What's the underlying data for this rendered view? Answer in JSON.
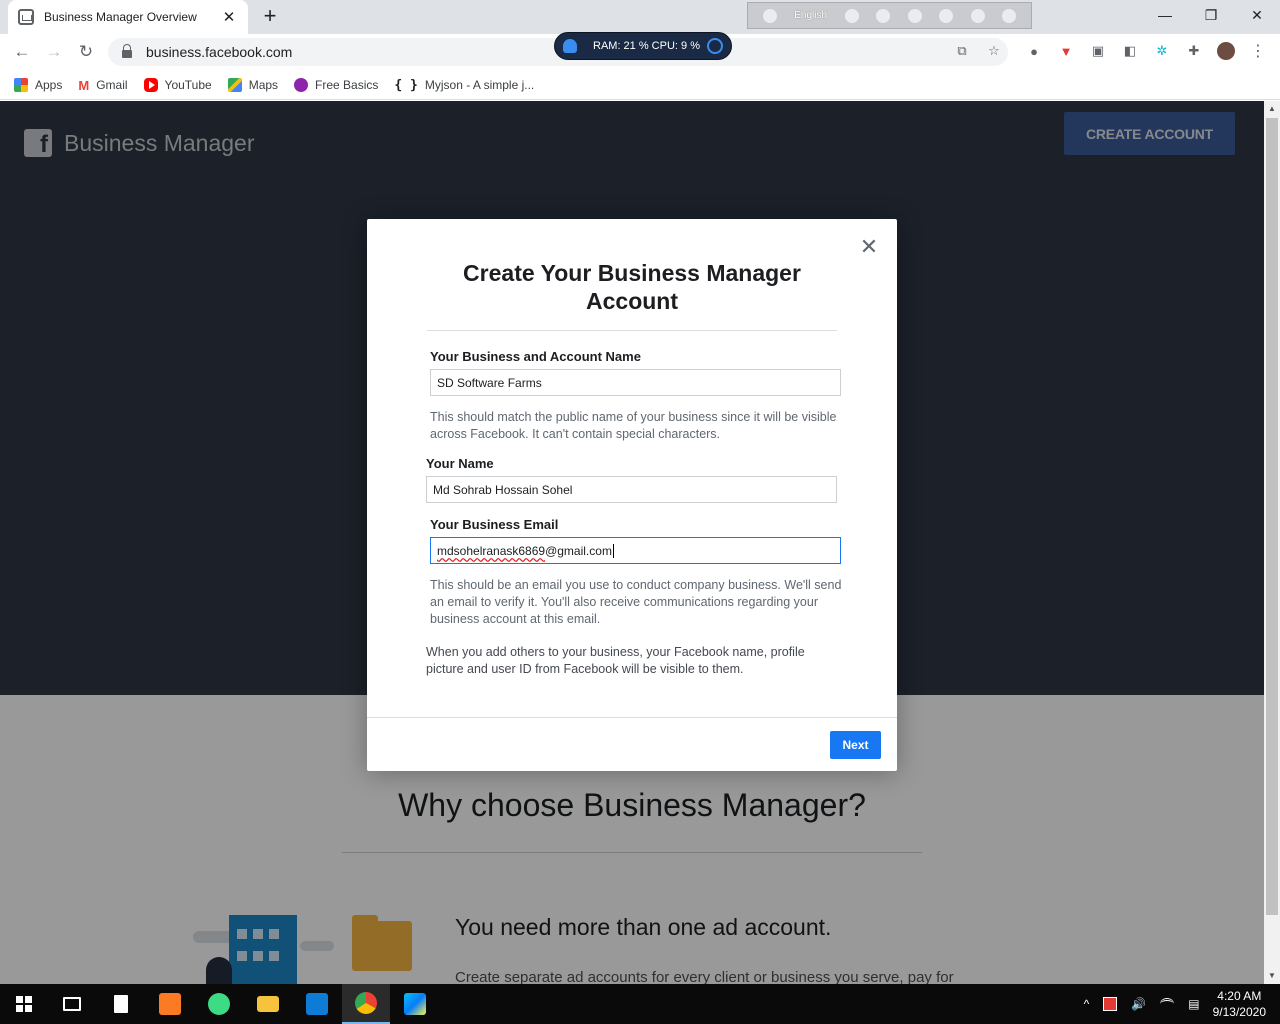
{
  "browser": {
    "tab_title": "Business Manager Overview",
    "tab_close": "✕",
    "new_tab": "+",
    "url": "business.facebook.com",
    "language_bar": {
      "language": "English"
    },
    "system_monitor": "RAM: 21 %  CPU: 9 %",
    "window_controls": {
      "minimize": "—",
      "restore": "❐",
      "close": "✕"
    },
    "nav": {
      "back": "←",
      "forward": "→",
      "reload": "↻"
    },
    "menu": "⋮"
  },
  "bookmarks": [
    {
      "label": "Apps",
      "icon": "apps-grid-icon"
    },
    {
      "label": "Gmail",
      "icon": "gmail-icon"
    },
    {
      "label": "YouTube",
      "icon": "youtube-icon"
    },
    {
      "label": "Maps",
      "icon": "maps-icon"
    },
    {
      "label": "Free Basics",
      "icon": "free-basics-icon"
    },
    {
      "label": "Myjson - A simple j...",
      "icon": "json-braces-icon"
    }
  ],
  "page": {
    "brand": "Business Manager",
    "brand_logo": "f",
    "create_account": "CREATE ACCOUNT",
    "why_heading": "Why choose Business Manager?",
    "feature_title": "You need more than one ad account.",
    "feature_desc": "Create separate ad accounts for every client or business you serve, pay for"
  },
  "modal": {
    "title": "Create Your Business Manager Account",
    "close": "✕",
    "business_name_label": "Your Business and Account Name",
    "business_name_value": "SD Software Farms",
    "business_name_help": "This should match the public name of your business since it will be visible across Facebook. It can't contain special characters.",
    "your_name_label": "Your Name",
    "your_name_value": "Md Sohrab Hossain Sohel",
    "email_label": "Your Business Email",
    "email_value_user": "mdsohelranask6869",
    "email_value_domain": "@gmail.com",
    "email_help": "This should be an email you use to conduct company business. We'll send an email to verify it. You'll also receive communications regarding your business account at this email.",
    "visibility_note": "When you add others to your business, your Facebook name, profile picture and user ID from Facebook will be visible to them.",
    "next": "Next"
  },
  "taskbar": {
    "clock_time": "4:20 AM",
    "clock_date": "9/13/2020",
    "tray_chevron": "^",
    "tray_volume": "🔊",
    "tray_notifications": "▤"
  },
  "colors": {
    "hero_bg": "#2e3645",
    "facebook_blue": "#1877f2",
    "create_button": "#3b5a99"
  }
}
